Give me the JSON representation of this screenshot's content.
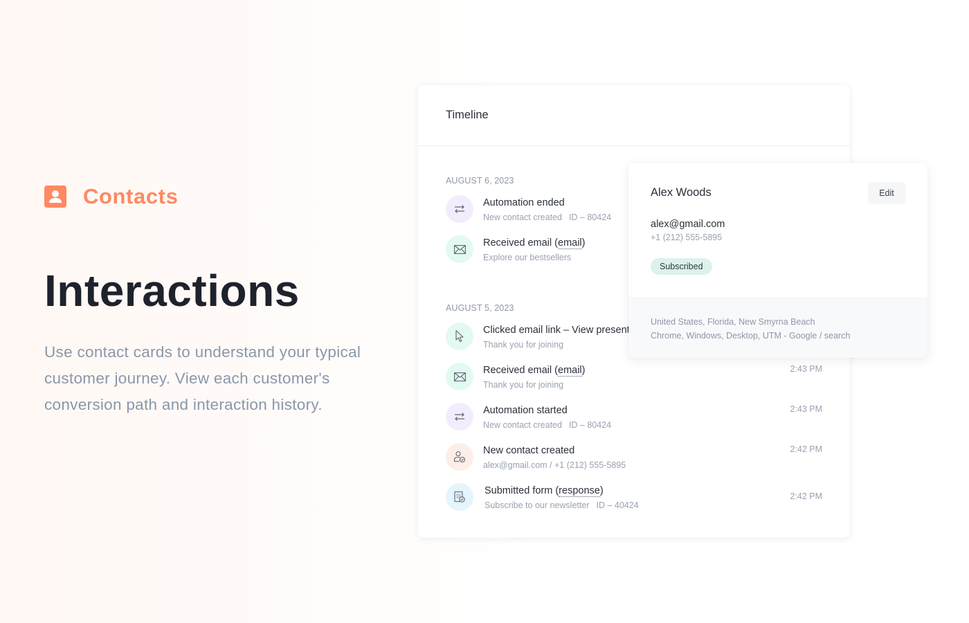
{
  "hero": {
    "brand_icon": "contact-card-icon",
    "brand_label": "Contacts",
    "title": "Interactions",
    "description": "Use contact cards to understand your typical customer journey. View each customer's conversion path and interaction history.",
    "accent_color": "#fe8963"
  },
  "timeline": {
    "title": "Timeline",
    "groups": [
      {
        "date": "AUGUST 6, 2023",
        "events": [
          {
            "icon": "automation-arrows-icon",
            "title": "Automation ended",
            "subtitle": "New contact created",
            "id": "ID – 80424",
            "time": ""
          },
          {
            "icon": "envelope-icon",
            "title_prefix": "Received email (",
            "title_link": "email",
            "title_suffix": ")",
            "subtitle": "Explore our bestsellers",
            "time": ""
          }
        ]
      },
      {
        "date": "AUGUST 5, 2023",
        "events": [
          {
            "icon": "cursor-pointer-icon",
            "title": "Clicked email link – View presentation",
            "subtitle": "Thank you for joining",
            "time": ""
          },
          {
            "icon": "envelope-icon",
            "title_prefix": "Received email (",
            "title_link": "email",
            "title_suffix": ")",
            "subtitle": "Thank you for joining",
            "time": "2:43 PM"
          },
          {
            "icon": "automation-arrows-icon",
            "title": "Automation started",
            "subtitle": "New contact created",
            "id": "ID – 80424",
            "time": "2:43 PM"
          },
          {
            "icon": "new-contact-icon",
            "title": "New contact created",
            "subtitle": "alex@gmail.com / +1 (212) 555-5895",
            "time": "2:42 PM"
          },
          {
            "icon": "form-submitted-icon",
            "title_prefix": "Submitted form (",
            "title_link": "response",
            "title_suffix": ")",
            "subtitle": "Subscribe to our newsletter",
            "id": "ID – 40424",
            "time": "2:42 PM"
          }
        ]
      }
    ]
  },
  "contact": {
    "name": "Alex Woods",
    "edit_label": "Edit",
    "email": "alex@gmail.com",
    "phone": "+1 (212) 555-5895",
    "status": "Subscribed",
    "status_color": "#ddf2ec",
    "location": "United States, Florida, New Smyrna Beach",
    "device": "Chrome, Windows, Desktop, UTM - Google / search"
  }
}
